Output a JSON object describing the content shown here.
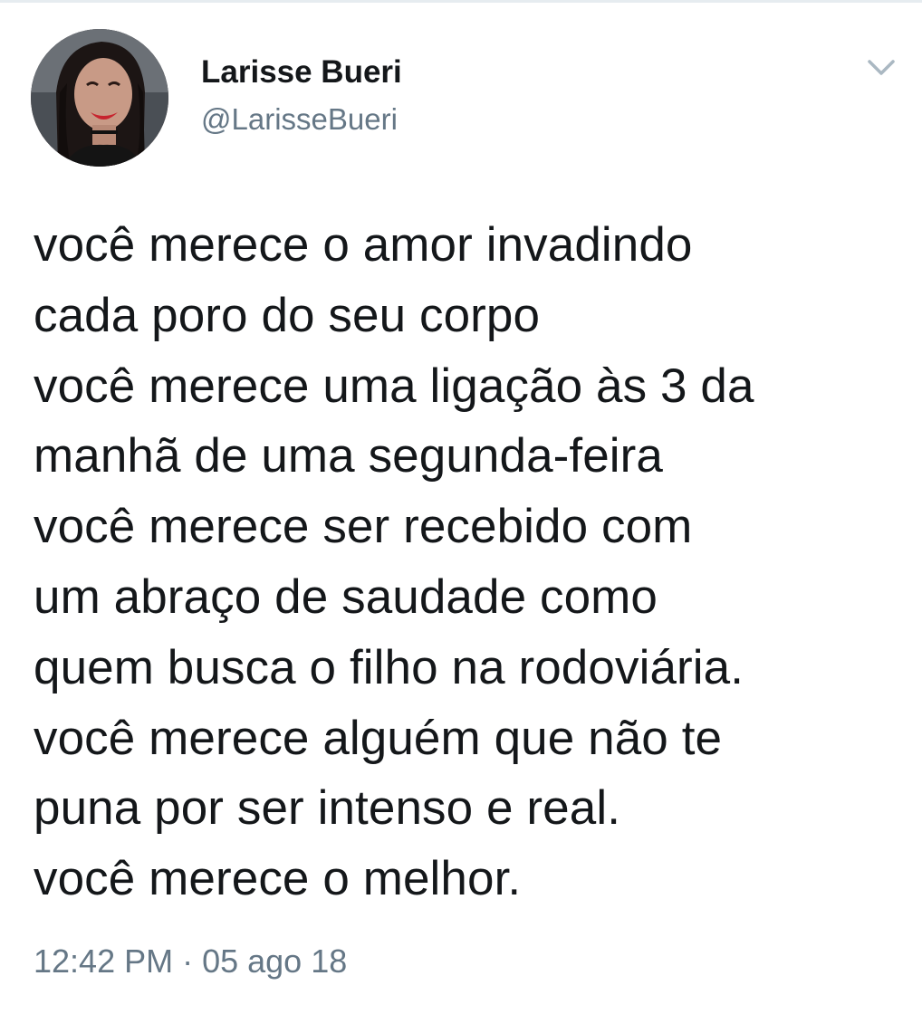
{
  "tweet": {
    "author": {
      "display_name": "Larisse Bueri",
      "handle": "@LarisseBueri"
    },
    "text": "você merece o amor invadindo\ncada poro do seu corpo\nvocê merece uma ligação às 3 da\nmanhã de uma segunda-feira\nvocê merece ser recebido com\num abraço de saudade como\nquem busca o filho na rodoviária.\nvocê merece alguém que não te\npuna por ser intenso e real.\nvocê merece o melhor.",
    "timestamp": "12:42 PM · 05 ago 18",
    "menu_icon": "chevron-down-icon"
  },
  "colors": {
    "text": "#14171a",
    "secondary_text": "#657786",
    "caret": "#aab8c2",
    "background": "#ffffff"
  }
}
